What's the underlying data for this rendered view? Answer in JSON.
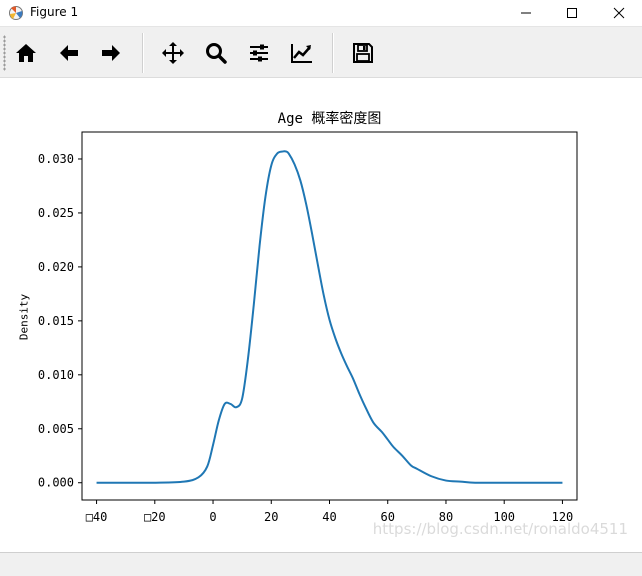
{
  "window": {
    "title": "Figure 1",
    "controls": {
      "minimize_icon": "minimize-icon",
      "maximize_icon": "maximize-icon",
      "close_icon": "close-icon"
    }
  },
  "toolbar": {
    "buttons": [
      {
        "name": "home",
        "icon": "home-icon"
      },
      {
        "name": "back",
        "icon": "arrow-left-icon"
      },
      {
        "name": "forward",
        "icon": "arrow-right-icon"
      },
      {
        "name": "pan",
        "icon": "move-icon"
      },
      {
        "name": "zoom",
        "icon": "magnifier-icon"
      },
      {
        "name": "subplots",
        "icon": "sliders-icon"
      },
      {
        "name": "customize",
        "icon": "chart-line-icon"
      },
      {
        "name": "save",
        "icon": "floppy-disk-icon"
      }
    ]
  },
  "chart_data": {
    "type": "line",
    "title": "Age 概率密度图",
    "xlabel": "",
    "ylabel": "Density",
    "xlim": [
      -45,
      125
    ],
    "ylim": [
      -0.0016,
      0.0325
    ],
    "xticks": [
      -40,
      -20,
      0,
      20,
      40,
      60,
      80,
      100,
      120
    ],
    "xtick_labels": [
      "□40",
      "□20",
      "0",
      "20",
      "40",
      "60",
      "80",
      "100",
      "120"
    ],
    "yticks": [
      0.0,
      0.005,
      0.01,
      0.015,
      0.02,
      0.025,
      0.03
    ],
    "ytick_labels": [
      "0.000",
      "0.005",
      "0.010",
      "0.015",
      "0.020",
      "0.025",
      "0.030"
    ],
    "grid": false,
    "series": [
      {
        "color": "#1f77b4",
        "x": [
          -40,
          -30,
          -20,
          -10,
          -5,
          -2,
          0,
          2,
          4,
          6,
          8,
          10,
          12,
          14,
          16,
          18,
          20,
          22,
          24,
          25,
          26,
          28,
          30,
          32,
          34,
          36,
          38,
          40,
          42,
          44,
          46,
          48,
          50,
          52,
          55,
          58,
          60,
          62,
          65,
          68,
          70,
          75,
          80,
          85,
          90,
          100,
          110,
          120
        ],
        "y": [
          0.0,
          0.0,
          0.0,
          0.0001,
          0.0005,
          0.0015,
          0.0035,
          0.0058,
          0.0073,
          0.0073,
          0.007,
          0.0078,
          0.0115,
          0.0165,
          0.022,
          0.0265,
          0.0294,
          0.0305,
          0.0307,
          0.0307,
          0.0305,
          0.0295,
          0.028,
          0.0258,
          0.0231,
          0.0202,
          0.0174,
          0.0151,
          0.0134,
          0.012,
          0.0108,
          0.0097,
          0.0084,
          0.0072,
          0.0056,
          0.0047,
          0.004,
          0.0033,
          0.0025,
          0.0016,
          0.0013,
          0.0006,
          0.0002,
          0.0001,
          0.0,
          0.0,
          0.0,
          0.0
        ]
      }
    ]
  },
  "status": {
    "text": ""
  },
  "watermark": "https://blog.csdn.net/ronaldo4511"
}
